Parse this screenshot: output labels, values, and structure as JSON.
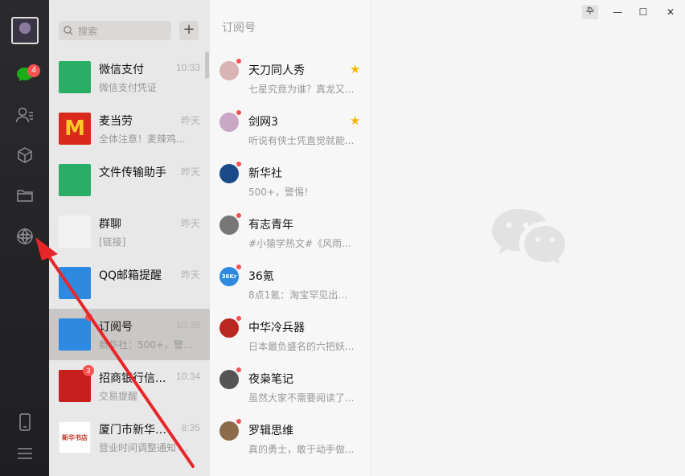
{
  "rail": {
    "chat_badge": "4"
  },
  "search": {
    "placeholder": "搜索",
    "add_label": "+"
  },
  "chats": [
    {
      "name": "微信支付",
      "time": "10:33",
      "preview": "微信支付凭证",
      "avatar_color": "#2aae67",
      "icon": "pay-icon"
    },
    {
      "name": "麦当劳",
      "time": "昨天",
      "preview": "全体注意！麦辣鸡...",
      "avatar_color": "#da291c",
      "icon": "mcdonalds-logo-icon",
      "avatar_text": "M"
    },
    {
      "name": "文件传输助手",
      "time": "昨天",
      "preview": "",
      "avatar_color": "#2aae67",
      "icon": "file-transfer-icon"
    },
    {
      "name": "群聊",
      "time": "昨天",
      "preview": "[链接]",
      "avatar_color": "#f2f2f2",
      "icon": "group-avatar-icon"
    },
    {
      "name": "QQ邮箱提醒",
      "time": "昨天",
      "preview": "",
      "avatar_color": "#2d8ae0",
      "icon": "mail-icon"
    },
    {
      "name": "订阅号",
      "time": "10:38",
      "preview": "新华社：500+，警...",
      "avatar_color": "#2d8ae0",
      "icon": "subscription-icon",
      "active": true,
      "dot": true
    },
    {
      "name": "招商银行信...",
      "time": "10:34",
      "preview": "交易提醒",
      "avatar_color": "#c81e1e",
      "icon": "cmb-bank-icon",
      "badge": "3"
    },
    {
      "name": "厦门市新华书店",
      "time": "8:35",
      "preview": "营业时间调整通知 ...",
      "avatar_color": "#ffffff",
      "icon": "bookstore-logo-icon",
      "avatar_text": "新华书店"
    }
  ],
  "subscriptions": {
    "title": "订阅号",
    "items": [
      {
        "name": "天刀同人秀",
        "preview": "七星究竟为谁？真龙又...",
        "starred": true,
        "avatar_color": "#d8b4b4"
      },
      {
        "name": "剑网3",
        "preview": "听说有侠士凭直觉就能...",
        "starred": true,
        "avatar_color": "#c9a7c7"
      },
      {
        "name": "新华社",
        "preview": "500+，警惕！",
        "starred": false,
        "avatar_color": "#1a4a8a"
      },
      {
        "name": "有志青年",
        "preview": "#小猿学热文#《风雨...",
        "starred": false,
        "avatar_color": "#777777"
      },
      {
        "name": "36氪",
        "preview": "8点1氪：淘宝罕见出现...",
        "starred": false,
        "avatar_color": "#2d8ae0",
        "avatar_text": "36Kr"
      },
      {
        "name": "中华冷兵器",
        "preview": "日本最负盛名的六把妖...",
        "starred": false,
        "avatar_color": "#b8281f"
      },
      {
        "name": "夜枭笔记",
        "preview": "虽然大家不需要阅读了...",
        "starred": false,
        "avatar_color": "#555555"
      },
      {
        "name": "罗辑思维",
        "preview": "真的勇士，敢于动手做...",
        "starred": false,
        "avatar_color": "#8a6b4a"
      }
    ]
  },
  "window": {
    "pin": "卆",
    "minimize": "—",
    "maximize": "☐",
    "close": "✕"
  }
}
